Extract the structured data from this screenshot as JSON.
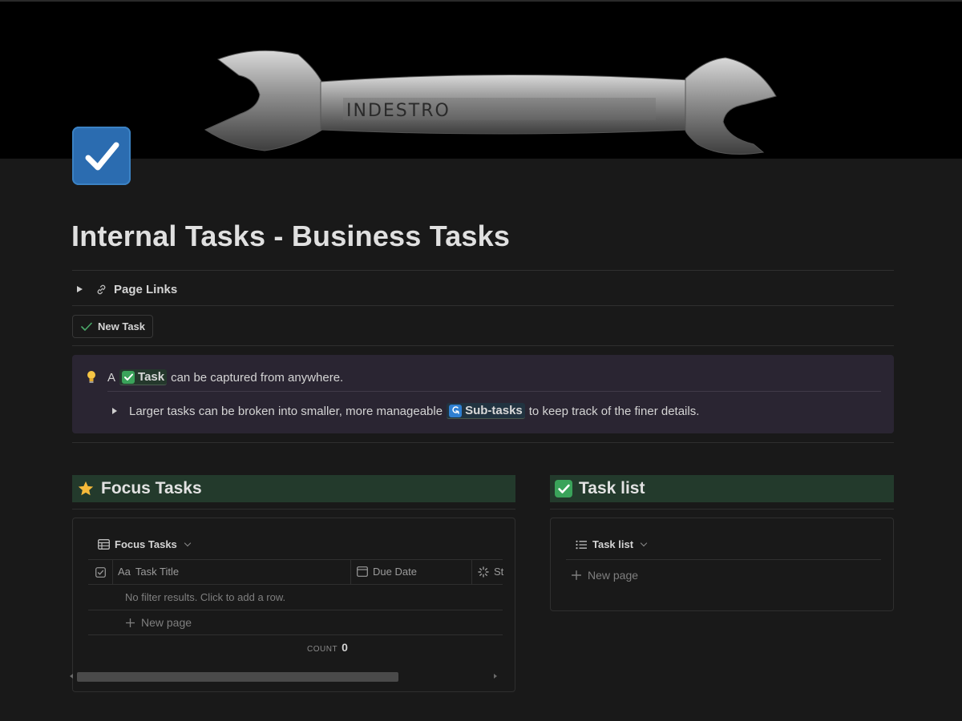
{
  "cover": {
    "image": "wrench",
    "engraving": "INDESTRO"
  },
  "page": {
    "icon": "check-box-icon",
    "title": "Internal Tasks - Business Tasks"
  },
  "toggle": {
    "label": "Page Links",
    "icon": "link-icon"
  },
  "buttons": {
    "new_task": "New Task"
  },
  "callout": {
    "line1_prefix": "A",
    "task_tag": "Task",
    "line1_suffix": "can be captured from anywhere.",
    "line2_prefix": "Larger tasks can be broken into smaller, more manageable",
    "subtask_tag": "Sub-tasks",
    "line2_suffix": "to keep track of the finer details."
  },
  "focus": {
    "heading": "Focus Tasks",
    "view_name": "Focus Tasks",
    "columns": [
      "Task Title",
      "Due Date",
      "St"
    ],
    "empty_text": "No filter results. Click to add a row.",
    "new_page": "New page",
    "count_label": "COUNT",
    "count_value": "0"
  },
  "tasklist": {
    "heading": "Task list",
    "view_name": "Task list",
    "new_page": "New page"
  },
  "colors": {
    "background": "#191919",
    "section_header": "#233a2c",
    "callout": "#2a2532",
    "accent_green": "#3aa35a",
    "accent_blue": "#2b6cb0"
  }
}
